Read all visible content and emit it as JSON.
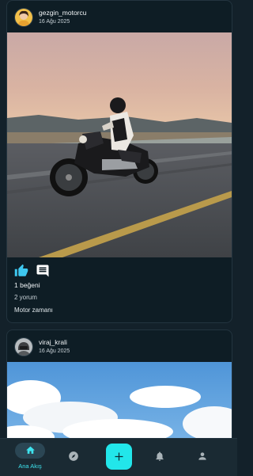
{
  "posts": [
    {
      "username": "gezgin_motorcu",
      "date": "16 Ağu 2025",
      "photo_icon": "motorcycle-photo",
      "likes": "1 beğeni",
      "comments": "2 yorum",
      "caption": "Motor zamanı",
      "liked": true
    },
    {
      "username": "viraj_krali",
      "date": "16 Ağu 2025",
      "photo_icon": "sky-clouds-photo"
    }
  ],
  "nav": {
    "home_label": "Ana Akış",
    "active": "home",
    "items": [
      "home-icon",
      "explore-icon",
      "add-icon",
      "notifications-icon",
      "profile-icon"
    ]
  },
  "colors": {
    "accent": "#22e6ea",
    "like_active": "#3ec8f0",
    "background": "#13212a",
    "card": "#0e1d25"
  }
}
